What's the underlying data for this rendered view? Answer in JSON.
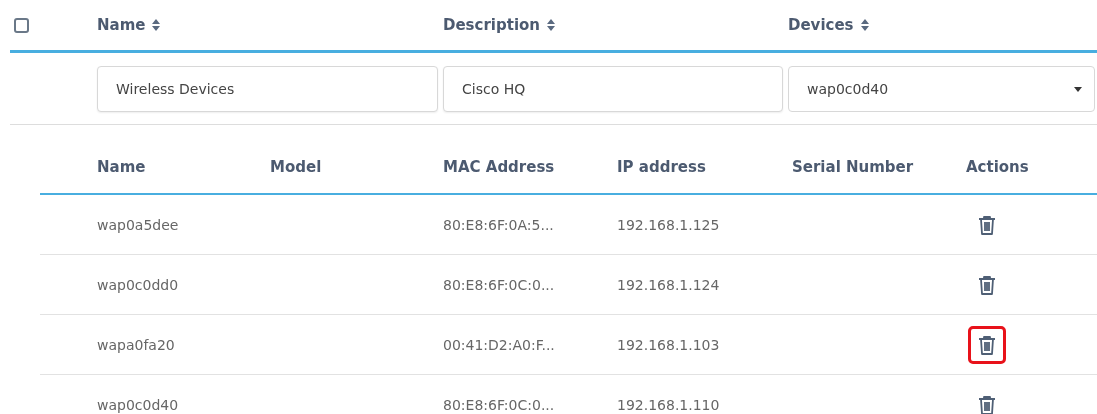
{
  "header": {
    "select_all": {
      "checked": false
    },
    "columns": [
      {
        "label": "Name",
        "sortable": true
      },
      {
        "label": "Description",
        "sortable": true
      },
      {
        "label": "Devices",
        "sortable": true
      }
    ]
  },
  "filters": {
    "name": {
      "value": "Wireless Devices"
    },
    "description": {
      "value": "Cisco HQ"
    },
    "devices": {
      "value": "wap0c0d40"
    }
  },
  "device_table": {
    "columns": [
      "Name",
      "Model",
      "MAC Address",
      "IP address",
      "Serial Number",
      "Actions"
    ],
    "rows": [
      {
        "name": "wap0a5dee",
        "mac": "80:E8:6F:0A:5...",
        "ip": "192.168.1.125",
        "highlighted": false
      },
      {
        "name": "wap0c0dd0",
        "mac": "80:E8:6F:0C:0...",
        "ip": "192.168.1.124",
        "highlighted": false
      },
      {
        "name": "wapa0fa20",
        "mac": "00:41:D2:A0:F...",
        "ip": "192.168.1.103",
        "highlighted": true
      },
      {
        "name": "wap0c0d40",
        "mac": "80:E8:6F:0C:0...",
        "ip": "192.168.1.110",
        "highlighted": false
      }
    ]
  }
}
